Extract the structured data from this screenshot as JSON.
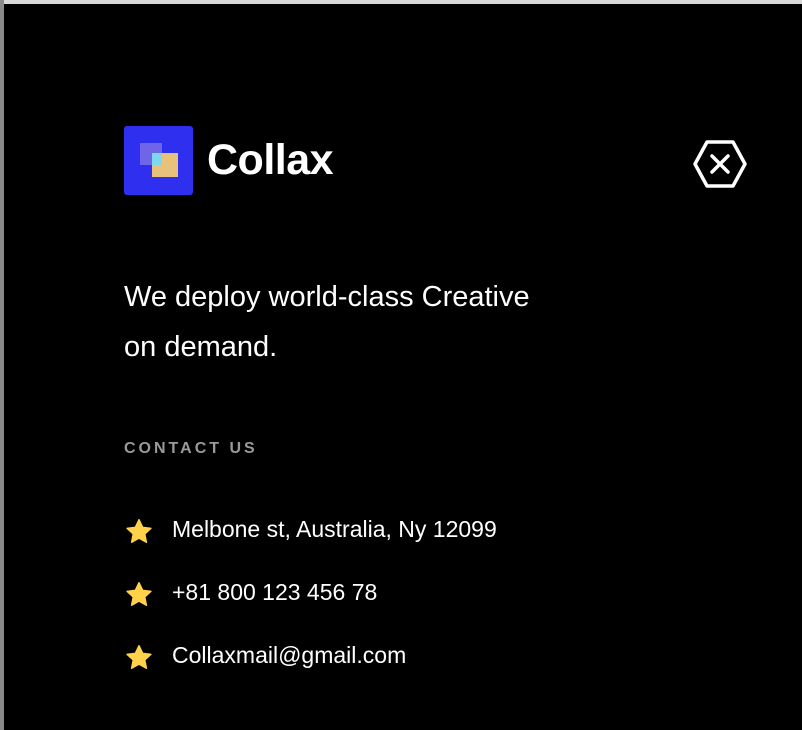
{
  "brand": {
    "name": "Collax",
    "logo_icon": "collax-logo-icon",
    "logo_color": "#2f2ff0"
  },
  "close": {
    "icon": "close-hexagon-icon"
  },
  "tagline": {
    "line1": "We deploy world-class Creative",
    "line2": "on demand."
  },
  "contact": {
    "heading": "CONTACT US",
    "icon": "star-icon",
    "icon_color": "#ffd24a",
    "items": [
      {
        "label": "Melbone st, Australia, Ny 12099"
      },
      {
        "label": "+81 800 123 456 78"
      },
      {
        "label": "Collaxmail@gmail.com"
      }
    ]
  },
  "colors": {
    "background": "#000000",
    "text": "#ffffff",
    "muted": "#9a9a9a"
  }
}
